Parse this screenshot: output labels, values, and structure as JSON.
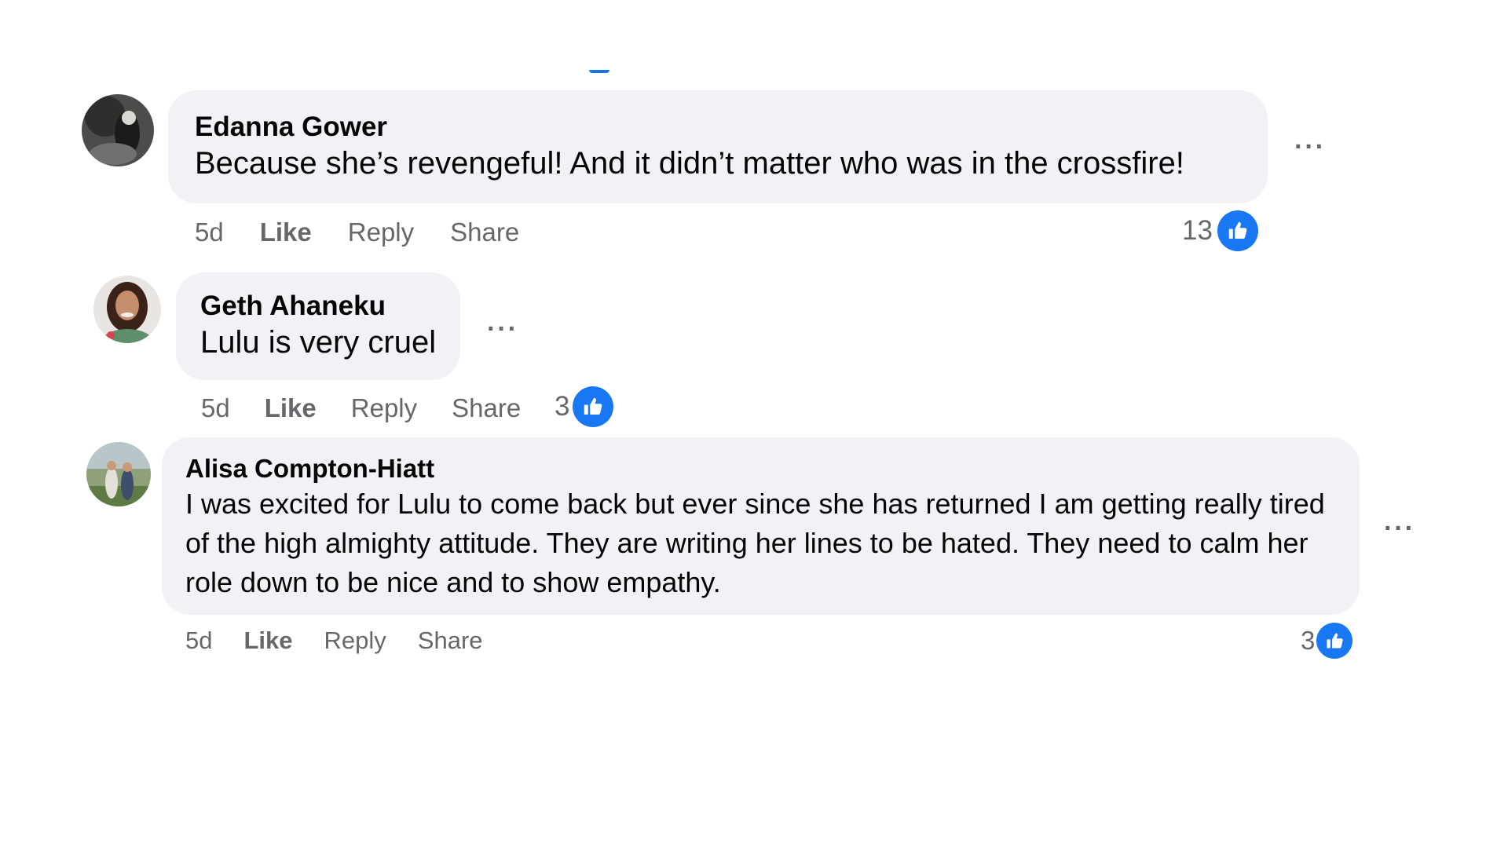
{
  "comments": [
    {
      "author": "Edanna Gower",
      "text": "Because she’s revengeful! And it didn’t matter who was in the crossfire!",
      "time": "5d",
      "like_label": "Like",
      "reply_label": "Reply",
      "share_label": "Share",
      "reaction_count": "13",
      "more_label": "···"
    },
    {
      "author": "Geth Ahaneku",
      "text": "Lulu is very cruel",
      "time": "5d",
      "like_label": "Like",
      "reply_label": "Reply",
      "share_label": "Share",
      "reaction_count": "3",
      "more_label": "···"
    },
    {
      "author": "Alisa Compton-Hiatt",
      "text": "I was excited for Lulu to come back but ever since she has returned I am getting really tired of the high almighty attitude. They are writing her lines to be hated. They need to calm her role down to be nice and to show empathy.",
      "time": "5d",
      "like_label": "Like",
      "reply_label": "Reply",
      "share_label": "Share",
      "reaction_count": "3",
      "more_label": "···"
    }
  ],
  "icons": {
    "reaction": "thumbs-up-icon",
    "more": "more-options-icon"
  },
  "colors": {
    "like_blue": "#1877f2",
    "bubble_bg": "#f0f2f5",
    "secondary_text": "#65676b"
  }
}
